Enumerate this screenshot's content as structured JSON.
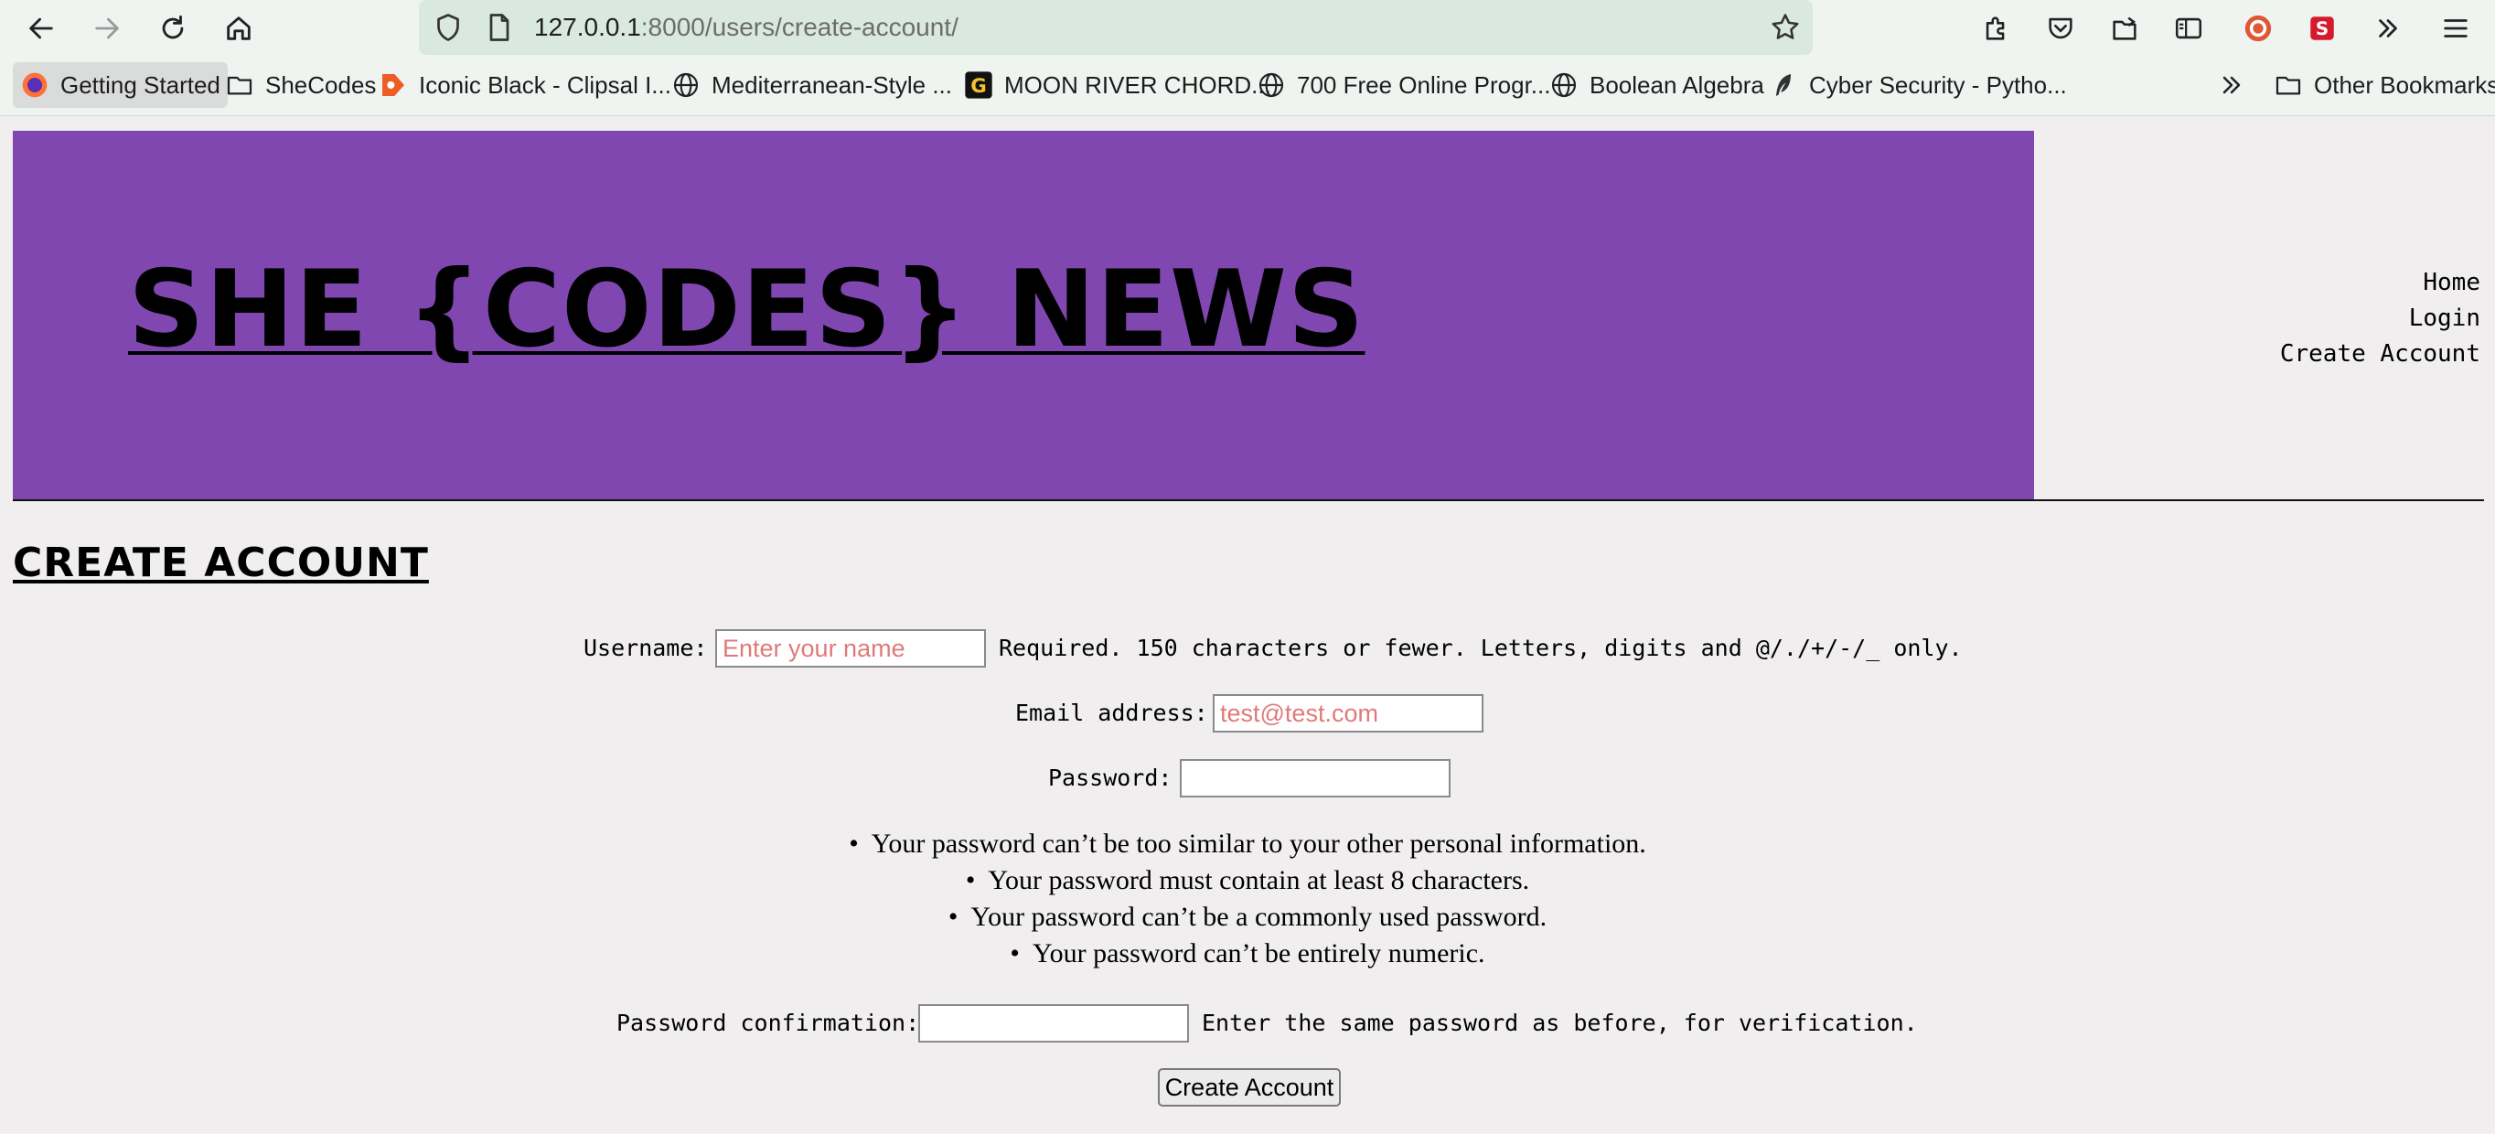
{
  "browser": {
    "url_host": "127.0.0.1",
    "url_rest": ":8000/users/create-account/",
    "bookmarks": [
      {
        "label": "Getting Started",
        "icon": "firefox-icon"
      },
      {
        "label": "SheCodes",
        "icon": "folder-icon"
      },
      {
        "label": "Iconic Black - Clipsal I...",
        "icon": "clipsal-icon"
      },
      {
        "label": "Mediterranean-Style ...",
        "icon": "globe-icon"
      },
      {
        "label": "MOON RIVER CHORD...",
        "icon": "g-icon"
      },
      {
        "label": "700 Free Online Progr...",
        "icon": "globe-icon"
      },
      {
        "label": "Boolean Algebra",
        "icon": "globe-icon"
      },
      {
        "label": "Cyber Security - Pytho...",
        "icon": "feather-icon"
      }
    ],
    "other_bookmarks": "Other Bookmarks"
  },
  "site": {
    "title": "SHE {CODES} NEWS",
    "header_color": "#8047b0",
    "nav": [
      "Home",
      "Login",
      "Create Account"
    ]
  },
  "page": {
    "title": "CREATE ACCOUNT"
  },
  "form": {
    "username_label": "Username:",
    "username_placeholder": "Enter your name",
    "username_help": "Required. 150 characters or fewer. Letters, digits and @/./+/-/_ only.",
    "email_label": "Email address:",
    "email_placeholder": "test@test.com",
    "password_label": "Password:",
    "password_rules": [
      "Your password can’t be too similar to your other personal information.",
      "Your password must contain at least 8 characters.",
      "Your password can’t be a commonly used password.",
      "Your password can’t be entirely numeric."
    ],
    "confirm_label": "Password confirmation:",
    "confirm_help": "Enter the same password as before, for verification.",
    "submit_label": "Create Account"
  }
}
